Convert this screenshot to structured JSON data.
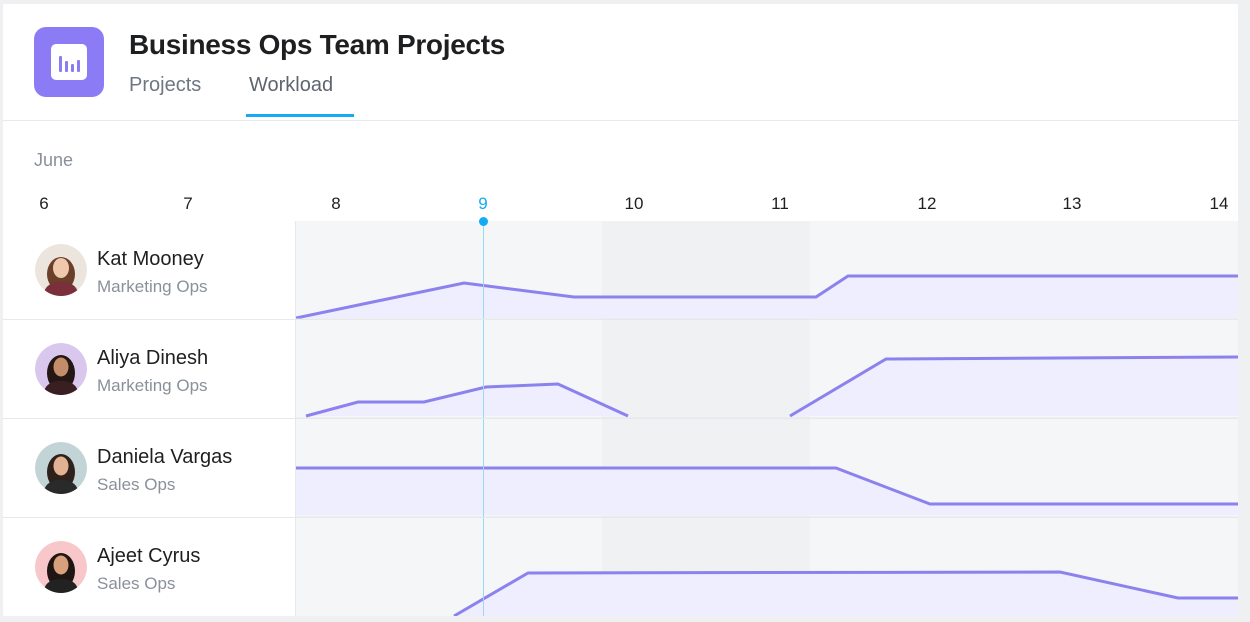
{
  "header": {
    "title": "Business Ops Team Projects",
    "tabs": [
      {
        "label": "Projects",
        "active": false
      },
      {
        "label": "Workload",
        "active": true
      }
    ]
  },
  "calendar": {
    "month": "June",
    "days": [
      "6",
      "7",
      "8",
      "9",
      "10",
      "11",
      "12",
      "13",
      "14"
    ],
    "today": "9"
  },
  "colors": {
    "accent": "#14aaf5",
    "brand": "#8b7cf6",
    "workload_line": "#8b82ee",
    "workload_fill": "#eeeefe"
  },
  "people": [
    {
      "name": "Kat Mooney",
      "team": "Marketing Ops",
      "avatar": "avatar-photo"
    },
    {
      "name": "Aliya Dinesh",
      "team": "Marketing Ops",
      "avatar": "avatar-photo"
    },
    {
      "name": "Daniela Vargas",
      "team": "Sales Ops",
      "avatar": "avatar-photo"
    },
    {
      "name": "Ajeet Cyrus",
      "team": "Sales Ops",
      "avatar": "avatar-photo"
    }
  ]
}
